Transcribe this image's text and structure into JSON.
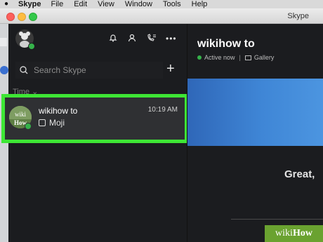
{
  "menubar": {
    "app_name": "Skype",
    "items": [
      "File",
      "Edit",
      "View",
      "Window",
      "Tools",
      "Help"
    ]
  },
  "window": {
    "title": "Skype"
  },
  "sidebar": {
    "search": {
      "placeholder": "Search Skype"
    },
    "sort_label": "Time",
    "conversations": [
      {
        "name": "wikihow to",
        "time": "10:19 AM",
        "last_message": "Moji",
        "avatar_text": "wiki How",
        "online": true
      }
    ]
  },
  "chat": {
    "title": "wikihow to",
    "status": "Active now",
    "gallery_label": "Gallery",
    "preview_text": "Great,"
  },
  "watermark": {
    "wiki": "wiki",
    "how": "How"
  },
  "colors": {
    "highlight_border": "#3ee635",
    "presence_green": "#35b24a",
    "banner_blue": "#3f86d6"
  }
}
